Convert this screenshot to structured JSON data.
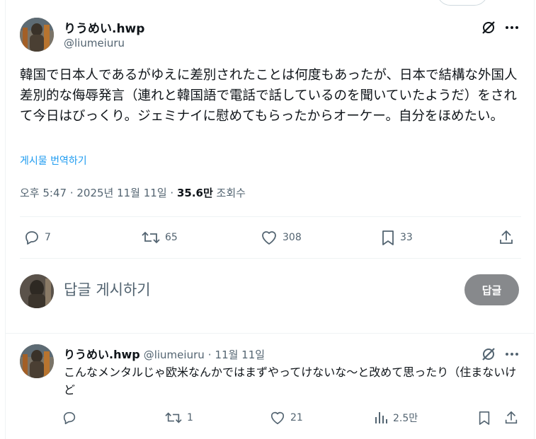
{
  "main_tweet": {
    "author_name": "りうめい.hwp",
    "author_handle": "@liumeiuru",
    "text": "韓国で日本人であるがゆえに差別されたことは何度もあったが、日本で結構な外国人差別的な侮辱発言（連れと韓国語で電話で話しているのを聞いていたようだ）をされて今日はびっくり。ジェミナイに慰めてもらったからオーケー。自分をほめたい。",
    "translate_label": "게시물 번역하기",
    "timestamp": "오후 5:47 · 2025년 11월 11일 · ",
    "views_count": "35.6만",
    "views_label": " 조회수",
    "actions": {
      "replies": "7",
      "retweets": "65",
      "likes": "308",
      "bookmarks": "33"
    }
  },
  "compose_reply": {
    "placeholder": "답글 게시하기",
    "button_label": "답글"
  },
  "reply_tweet": {
    "author_name": "りうめい.hwp",
    "author_handle": "@liumeiuru",
    "dot": "·",
    "date": "11월 11일",
    "text": "こんなメンタルじゃ欧米なんかではまずやってけないな〜と改めて思ったり（住まないけど",
    "actions": {
      "replies": "",
      "retweets": "1",
      "likes": "21",
      "views": "2.5만"
    }
  },
  "icons": [
    "grok-icon",
    "more-icon",
    "reply-icon",
    "retweet-icon",
    "like-icon",
    "bookmark-icon",
    "share-icon",
    "views-icon"
  ],
  "colors": {
    "accent": "#1d9bf0",
    "muted": "#536471",
    "text": "#0f1419",
    "reply_button": "#87898c"
  }
}
